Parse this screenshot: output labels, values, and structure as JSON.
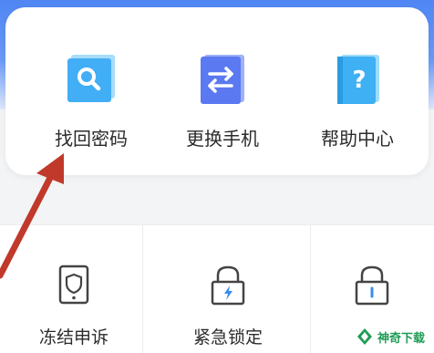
{
  "quick_actions": [
    {
      "label": "找回密码",
      "icon": "search-icon"
    },
    {
      "label": "更换手机",
      "icon": "swap-icon"
    },
    {
      "label": "帮助中心",
      "icon": "help-book-icon"
    }
  ],
  "security_items": [
    {
      "label": "冻结申诉",
      "icon": "shield-phone-icon"
    },
    {
      "label": "紧急锁定",
      "icon": "lock-lightning-icon"
    }
  ],
  "partial_item": {
    "icon": "lock-icon"
  },
  "watermark": {
    "text": "神奇下载"
  },
  "colors": {
    "accent_blue": "#4aa7f5",
    "arrow_red": "#c0392b",
    "text": "#2b2b2b"
  }
}
